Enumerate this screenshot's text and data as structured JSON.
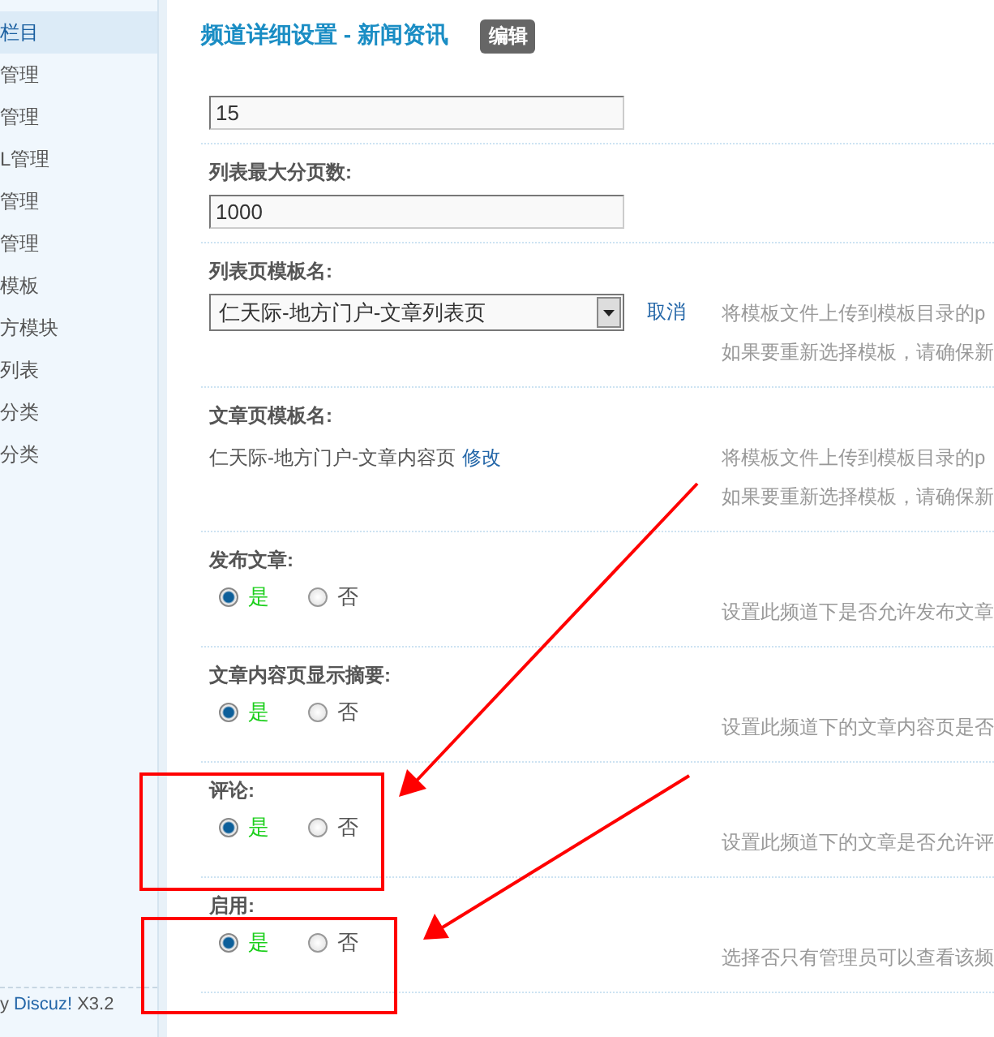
{
  "sidebar": {
    "items": [
      {
        "label": "栏目",
        "selected": true
      },
      {
        "label": "管理",
        "selected": false
      },
      {
        "label": "管理",
        "selected": false
      },
      {
        "label": "L管理",
        "selected": false
      },
      {
        "label": "管理",
        "selected": false
      },
      {
        "label": "管理",
        "selected": false
      },
      {
        "label": "模板",
        "selected": false
      },
      {
        "label": "方模块",
        "selected": false
      },
      {
        "label": "列表",
        "selected": false
      },
      {
        "label": "分类",
        "selected": false
      },
      {
        "label": "分类",
        "selected": false
      }
    ],
    "footer": {
      "prefix": "y",
      "link": "Discuz!",
      "suffix": "X3.2"
    }
  },
  "header": {
    "title": "频道详细设置 - 新闻资讯",
    "edit_button": "编辑"
  },
  "rows": [
    {
      "kind": "input",
      "value": "15"
    },
    {
      "kind": "input",
      "label": "列表最大分页数:",
      "value": "1000"
    },
    {
      "kind": "select",
      "label": "列表页模板名:",
      "value": "仁天际-地方门户-文章列表页",
      "link": "取消",
      "help": [
        "将模板文件上传到模板目录的p",
        "如果要重新选择模板，请确保新"
      ]
    },
    {
      "kind": "text",
      "label": "文章页模板名:",
      "value": "仁天际-地方门户-文章内容页",
      "link": "修改",
      "help": [
        "将模板文件上传到模板目录的p",
        "如果要重新选择模板，请确保新"
      ]
    },
    {
      "kind": "radio",
      "label": "发布文章:",
      "options": [
        {
          "label": "是",
          "selected": true
        },
        {
          "label": "否",
          "selected": false
        }
      ],
      "help": [
        "设置此频道下是否允许发布文章"
      ]
    },
    {
      "kind": "radio",
      "label": "文章内容页显示摘要:",
      "options": [
        {
          "label": "是",
          "selected": true
        },
        {
          "label": "否",
          "selected": false
        }
      ],
      "help": [
        "设置此频道下的文章内容页是否"
      ]
    },
    {
      "kind": "radio",
      "label": "评论:",
      "options": [
        {
          "label": "是",
          "selected": true
        },
        {
          "label": "否",
          "selected": false
        }
      ],
      "help": [
        "设置此频道下的文章是否允许评"
      ]
    },
    {
      "kind": "radio",
      "label": "启用:",
      "options": [
        {
          "label": "是",
          "selected": true
        },
        {
          "label": "否",
          "selected": false
        }
      ],
      "help": [
        "选择否只有管理员可以查看该频"
      ]
    }
  ]
}
